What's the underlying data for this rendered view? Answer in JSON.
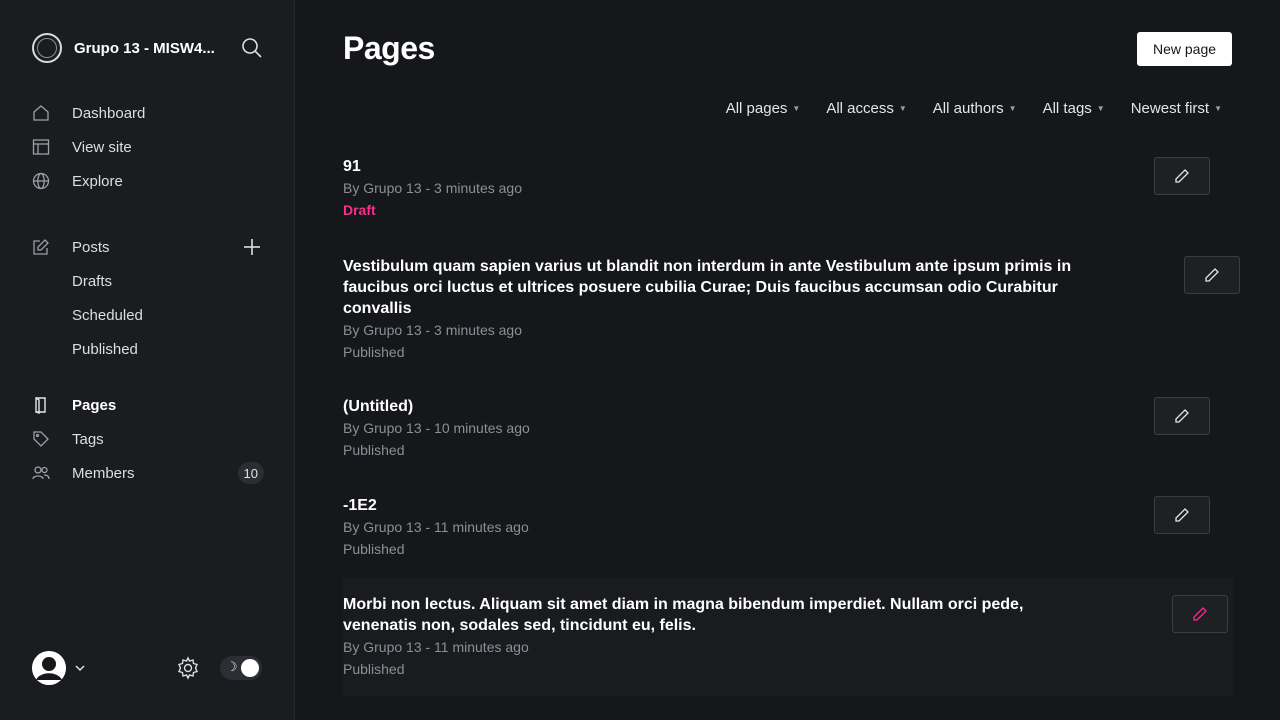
{
  "sidebar": {
    "site_name": "Grupo 13 - MISW4...",
    "nav_main": [
      {
        "label": "Dashboard",
        "icon": "home-icon"
      },
      {
        "label": "View site",
        "icon": "layout-icon"
      },
      {
        "label": "Explore",
        "icon": "globe-icon"
      }
    ],
    "posts": {
      "label": "Posts",
      "sub": [
        "Drafts",
        "Scheduled",
        "Published"
      ]
    },
    "nav_bottom": [
      {
        "label": "Pages",
        "icon": "page-icon",
        "active": true
      },
      {
        "label": "Tags",
        "icon": "tag-icon"
      },
      {
        "label": "Members",
        "icon": "members-icon",
        "count": "10"
      }
    ]
  },
  "main": {
    "title": "Pages",
    "new_page_label": "New page",
    "filters": [
      "All pages",
      "All access",
      "All authors",
      "All tags",
      "Newest first"
    ],
    "pages": [
      {
        "title": "91",
        "meta": "By Grupo 13 - 3 minutes ago",
        "status": "Draft"
      },
      {
        "title": "Vestibulum quam sapien varius ut blandit non interdum in ante Vestibulum ante ipsum primis in faucibus orci luctus et ultrices posuere cubilia Curae; Duis faucibus accumsan odio Curabitur convallis",
        "meta": "By Grupo 13 - 3 minutes ago",
        "status": "Published"
      },
      {
        "title": "(Untitled)",
        "meta": "By Grupo 13 - 10 minutes ago",
        "status": "Published"
      },
      {
        "title": "-1E2",
        "meta": "By Grupo 13 - 11 minutes ago",
        "status": "Published"
      },
      {
        "title": "Morbi non lectus. Aliquam sit amet diam in magna bibendum imperdiet. Nullam orci pede, venenatis non, sodales sed, tincidunt eu, felis.",
        "meta": "By Grupo 13 - 11 minutes ago",
        "status": "Published"
      }
    ]
  },
  "colors": {
    "background": "#15171a",
    "sidebar": "#1a1c20",
    "accent_pink": "#fb2d8d",
    "muted_text": "#8b8f96"
  }
}
